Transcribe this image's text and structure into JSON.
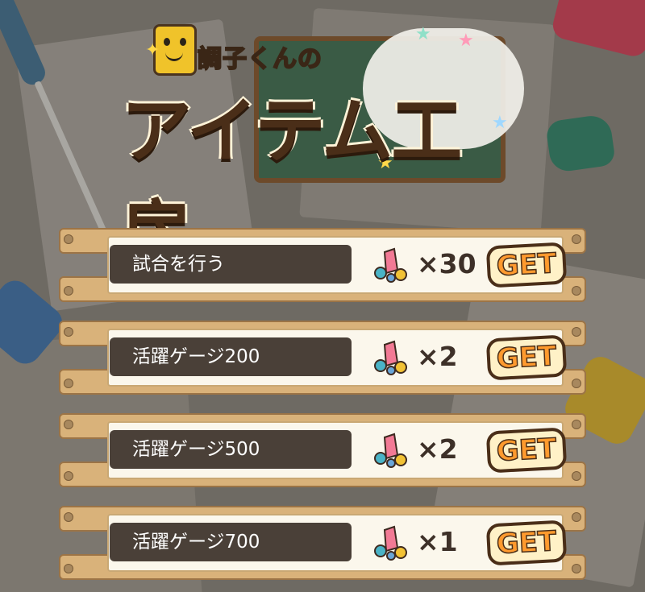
{
  "logo": {
    "subtitle": "調子くんの",
    "title": "アイテム工房"
  },
  "missions": [
    {
      "label": "試合を行う",
      "multiplier": "×30",
      "button": "GET"
    },
    {
      "label": "活躍ゲージ200",
      "multiplier": "×2",
      "button": "GET"
    },
    {
      "label": "活躍ゲージ500",
      "multiplier": "×2",
      "button": "GET"
    },
    {
      "label": "活躍ゲージ700",
      "multiplier": "×1",
      "button": "GET"
    }
  ],
  "icons": {
    "reward": "gem-pile-icon",
    "mascot": "mascot-icon",
    "decor": [
      "screwdriver",
      "gem-red",
      "gem-green",
      "gem-blue",
      "gem-yellow"
    ]
  },
  "colors": {
    "label_bg": "#4a4038",
    "plank": "#d9b27a",
    "get_text": "#ff9a2e",
    "get_bg": "#fff1c7"
  }
}
